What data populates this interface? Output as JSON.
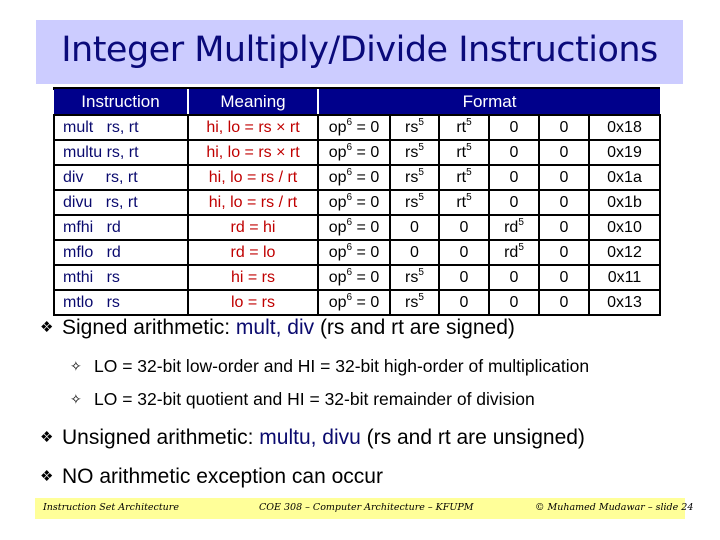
{
  "slide": {
    "title": "Integer Multiply/Divide Instructions",
    "colors": {
      "title_background": "#ccccff",
      "title_text": "#0a0a7a",
      "table_header_background": "#00008b",
      "meaning_text": "#c00000",
      "instruction_text": "#0a0a6e",
      "footer_background": "#ffff99"
    }
  },
  "table": {
    "headers": {
      "instruction": "Instruction",
      "meaning": "Meaning",
      "format": "Format"
    },
    "rows": [
      {
        "instruction": "mult   rs, rt",
        "meaning": "hi, lo = rs × rt",
        "op": "op",
        "op_sup": "6",
        "op_val": " = 0",
        "f1": "rs",
        "f1_sup": "5",
        "f2": "rt",
        "f2_sup": "5",
        "f3": "0",
        "f3_sup": "",
        "f4": "0",
        "funct": "0x18"
      },
      {
        "instruction": "multu rs, rt",
        "meaning": "hi, lo = rs × rt",
        "op": "op",
        "op_sup": "6",
        "op_val": " = 0",
        "f1": "rs",
        "f1_sup": "5",
        "f2": "rt",
        "f2_sup": "5",
        "f3": "0",
        "f3_sup": "",
        "f4": "0",
        "funct": "0x19"
      },
      {
        "instruction": "div     rs, rt",
        "meaning": "hi, lo = rs / rt",
        "op": "op",
        "op_sup": "6",
        "op_val": " = 0",
        "f1": "rs",
        "f1_sup": "5",
        "f2": "rt",
        "f2_sup": "5",
        "f3": "0",
        "f3_sup": "",
        "f4": "0",
        "funct": "0x1a"
      },
      {
        "instruction": "divu   rs, rt",
        "meaning": "hi, lo = rs / rt",
        "op": "op",
        "op_sup": "6",
        "op_val": " = 0",
        "f1": "rs",
        "f1_sup": "5",
        "f2": "rt",
        "f2_sup": "5",
        "f3": "0",
        "f3_sup": "",
        "f4": "0",
        "funct": "0x1b"
      },
      {
        "instruction": "mfhi   rd",
        "meaning": "rd = hi",
        "op": "op",
        "op_sup": "6",
        "op_val": " = 0",
        "f1": "0",
        "f1_sup": "",
        "f2": "0",
        "f2_sup": "",
        "f3": "rd",
        "f3_sup": "5",
        "f4": "0",
        "funct": "0x10"
      },
      {
        "instruction": "mflo   rd",
        "meaning": "rd = lo",
        "op": "op",
        "op_sup": "6",
        "op_val": " = 0",
        "f1": "0",
        "f1_sup": "",
        "f2": "0",
        "f2_sup": "",
        "f3": "rd",
        "f3_sup": "5",
        "f4": "0",
        "funct": "0x12"
      },
      {
        "instruction": "mthi   rs",
        "meaning": "hi = rs",
        "op": "op",
        "op_sup": "6",
        "op_val": " = 0",
        "f1": "rs",
        "f1_sup": "5",
        "f2": "0",
        "f2_sup": "",
        "f3": "0",
        "f3_sup": "",
        "f4": "0",
        "funct": "0x11"
      },
      {
        "instruction": "mtlo   rs",
        "meaning": "lo = rs",
        "op": "op",
        "op_sup": "6",
        "op_val": " = 0",
        "f1": "rs",
        "f1_sup": "5",
        "f2": "0",
        "f2_sup": "",
        "f3": "0",
        "f3_sup": "",
        "f4": "0",
        "funct": "0x13"
      }
    ]
  },
  "bullets": {
    "main_glyph": "❖",
    "sub_glyph": "✧",
    "signed": {
      "prefix": "Signed arithmetic: ",
      "highlight": "mult, div",
      "suffix": " (rs and rt are signed)"
    },
    "signed_sub": [
      "LO = 32-bit low-order and HI = 32-bit high-order of multiplication",
      "LO = 32-bit quotient and HI = 32-bit remainder of division"
    ],
    "unsigned": {
      "prefix": "Unsigned arithmetic: ",
      "highlight": "multu, divu",
      "suffix": " (rs and rt are unsigned)"
    },
    "no_exception": "NO arithmetic exception can occur"
  },
  "footer": {
    "left": "Instruction Set Architecture",
    "center": "COE 308 – Computer Architecture – KFUPM",
    "right": "© Muhamed Mudawar – slide 24"
  }
}
